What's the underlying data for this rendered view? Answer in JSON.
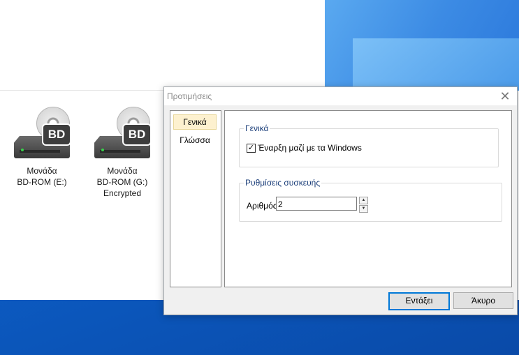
{
  "explorer": {
    "drives": [
      {
        "label": "Μονάδα\nBD-ROM (E:)",
        "line1": "Μονάδα",
        "line2": "BD-ROM (E:)",
        "line3": "",
        "badge": "BD",
        "icon": "bd-drive-icon"
      },
      {
        "label": "Μονάδα\nBD-ROM (G:)\nEncrypted",
        "line1": "Μονάδα",
        "line2": "BD-ROM (G:)",
        "line3": "Encrypted",
        "badge": "BD",
        "icon": "bd-drive-icon"
      }
    ]
  },
  "dialog": {
    "title": "Προτιμήσεις",
    "close_icon": "close-icon",
    "nav": {
      "items": [
        {
          "label": "Γενικά",
          "selected": true
        },
        {
          "label": "Γλώσσα",
          "selected": false
        }
      ]
    },
    "general_group": {
      "label": "Γενικά",
      "startup_checkbox": {
        "label": "Έναρξη μαζί με τα Windows",
        "checked": true,
        "mark": "☑"
      }
    },
    "device_group": {
      "label": "Ρυθμίσεις συσκευής",
      "number_label": "Αριθμός",
      "number_value": "2"
    },
    "buttons": {
      "ok": "Εντάξει",
      "cancel": "Άκυρο"
    }
  },
  "colors": {
    "accent": "#0078d7",
    "selected_nav": "#fdf1cf",
    "group_label": "#1c3f7a",
    "desktop_blue": "#0c5ec7"
  }
}
